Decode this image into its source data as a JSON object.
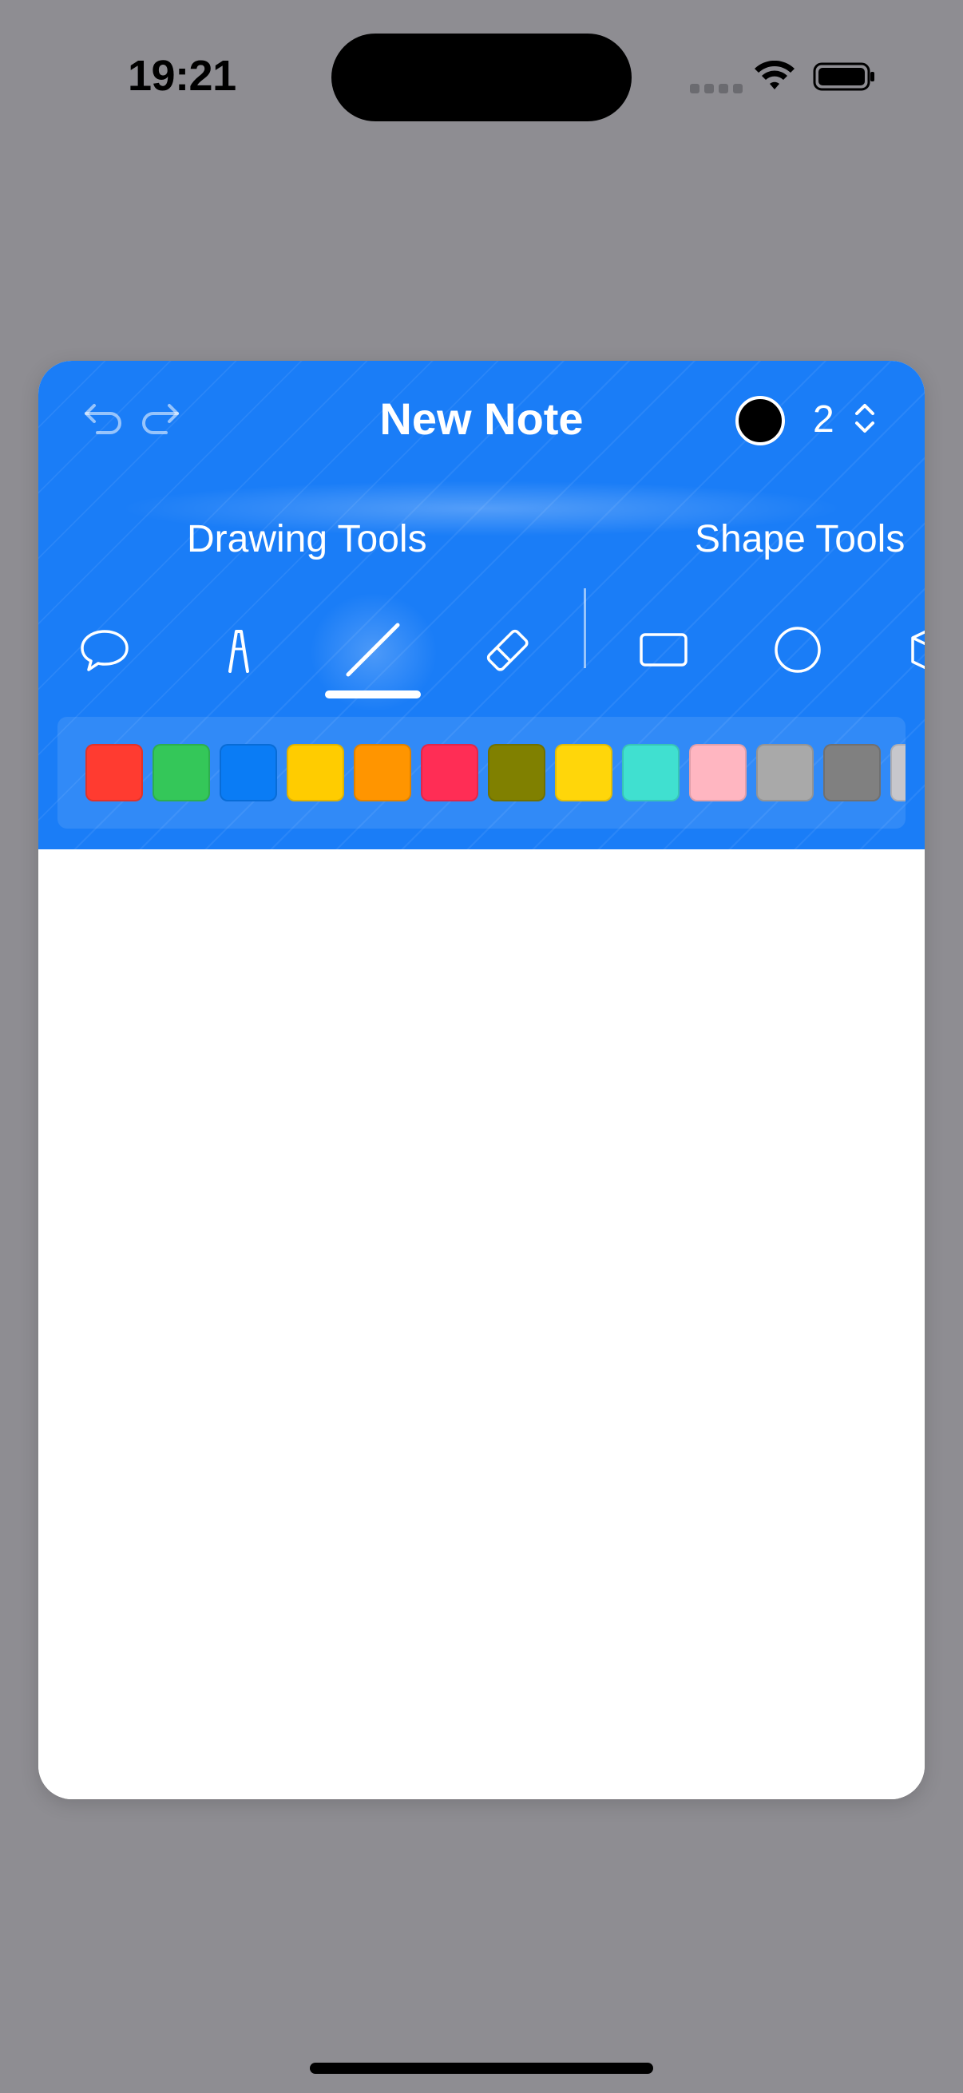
{
  "status_bar": {
    "time": "19:21"
  },
  "note": {
    "title": "New Note",
    "selected_color": "#000000",
    "stroke_width": "2"
  },
  "sections": {
    "drawing_label": "Drawing Tools",
    "shape_label": "Shape Tools"
  },
  "tools": [
    {
      "name": "speech-bubble",
      "active": false
    },
    {
      "name": "pen",
      "active": false
    },
    {
      "name": "line",
      "active": true
    },
    {
      "name": "eraser",
      "active": false
    },
    {
      "name": "rectangle",
      "active": false
    },
    {
      "name": "circle",
      "active": false
    },
    {
      "name": "cube",
      "active": false
    }
  ],
  "palette": {
    "colors": [
      "#ff3b30",
      "#34c759",
      "#0a7cf5",
      "#ffcc00",
      "#ff9500",
      "#ff2d55",
      "#808000",
      "#ffd60a",
      "#40e0d0",
      "#ffb6c1",
      "#a9a9a9",
      "#808080",
      "#c7c7cc"
    ]
  },
  "theme": {
    "accent": "#1a7df7",
    "background": "#8e8d92"
  }
}
